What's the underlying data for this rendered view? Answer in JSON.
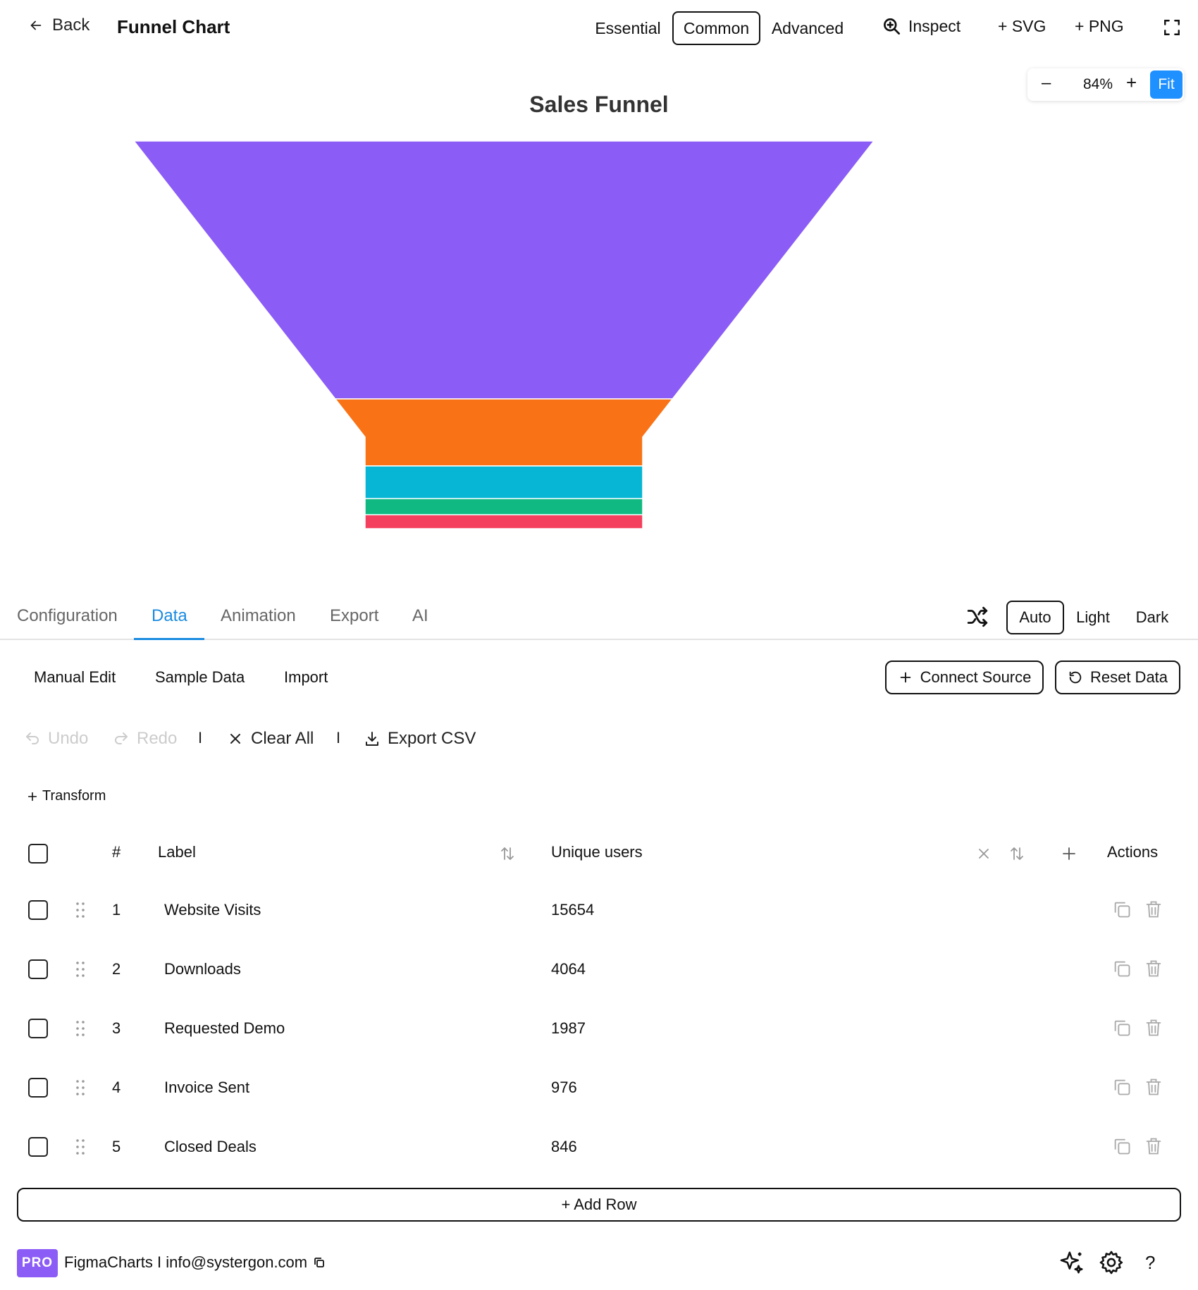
{
  "header": {
    "back_label": "Back",
    "title": "Funnel Chart",
    "tiers": [
      "Essential",
      "Common",
      "Advanced"
    ],
    "inspect_label": "Inspect",
    "svg_label": "+ SVG",
    "png_label": "+ PNG"
  },
  "zoom": {
    "minus": "–",
    "value": "84%",
    "plus": "+",
    "fit": "Fit"
  },
  "chart_data": {
    "type": "funnel",
    "title": "Sales Funnel",
    "categories": [
      "Website Visits",
      "Downloads",
      "Requested Demo",
      "Invoice Sent",
      "Closed Deals"
    ],
    "values": [
      15654,
      4064,
      1987,
      976,
      846
    ],
    "colors": [
      "#8b5cf6",
      "#f97316",
      "#06b6d4",
      "#10b981",
      "#f43f5e"
    ]
  },
  "panel": {
    "tabs": [
      "Configuration",
      "Data",
      "Animation",
      "Export",
      "AI"
    ],
    "active_tab": "Data",
    "themes": [
      "Auto",
      "Light",
      "Dark"
    ],
    "active_theme": "Auto"
  },
  "subtabs": [
    "Manual Edit",
    "Sample Data",
    "Import"
  ],
  "buttons": {
    "connect": "Connect Source",
    "reset": "Reset Data"
  },
  "toolbar": {
    "undo": "Undo",
    "redo": "Redo",
    "clear": "Clear All",
    "export_csv": "Export CSV",
    "separator": "I"
  },
  "transform_label": "Transform",
  "table": {
    "headers": {
      "index": "#",
      "label": "Label",
      "value": "Unique users",
      "actions": "Actions"
    },
    "rows": [
      {
        "index": "1",
        "label": "Website Visits",
        "value": "15654"
      },
      {
        "index": "2",
        "label": "Downloads",
        "value": "4064"
      },
      {
        "index": "3",
        "label": "Requested Demo",
        "value": "1987"
      },
      {
        "index": "4",
        "label": "Invoice Sent",
        "value": "976"
      },
      {
        "index": "5",
        "label": "Closed Deals",
        "value": "846"
      }
    ]
  },
  "add_row_label": "+ Add Row",
  "footer": {
    "badge": "PRO",
    "text": "FigmaCharts I info@systergon.com",
    "help": "?"
  }
}
